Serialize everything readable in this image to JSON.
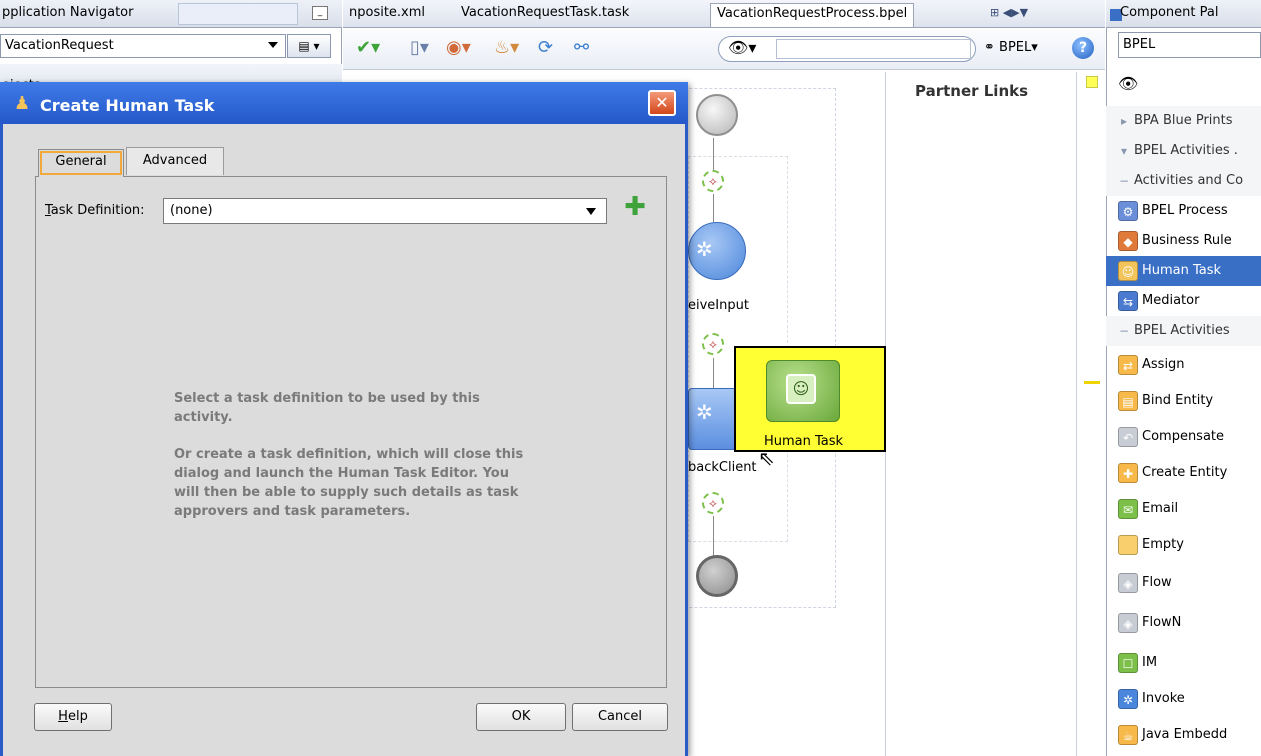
{
  "navigator": {
    "title": "pplication Navigator",
    "app_name": "VacationRequest",
    "projects_label": "ojects"
  },
  "editor": {
    "tabs": [
      {
        "label": "nposite.xml"
      },
      {
        "label": "VacationRequestTask.task"
      },
      {
        "label": "VacationRequestProcess.bpel"
      }
    ],
    "search_mode": "BPEL▾",
    "help_glyph": "?",
    "partner_links_title": "Partner Links",
    "nodes": {
      "receive_label": "eiveInput",
      "callback_label": "backClient"
    },
    "drag_item_label": "Human Task"
  },
  "palette": {
    "title": "Component Pal",
    "selected_category": "BPEL",
    "items": [
      {
        "label": "BPA Blue Prints",
        "kind": "collapsed-section",
        "icon": "triangle-right-icon"
      },
      {
        "label": "BPEL Activities .",
        "kind": "expanded-section",
        "icon": "triangle-down-icon"
      },
      {
        "label": "Activities and Co",
        "kind": "subsection",
        "icon": "minus-icon"
      },
      {
        "label": "BPEL Process",
        "kind": "item",
        "icon": "bpel-process-icon",
        "color": "#6a8fd8"
      },
      {
        "label": "Business Rule",
        "kind": "item",
        "icon": "business-rule-icon",
        "color": "#e07a3a"
      },
      {
        "label": "Human Task",
        "kind": "selected",
        "icon": "human-task-icon",
        "color": "#f2c45a"
      },
      {
        "label": "Mediator",
        "kind": "item",
        "icon": "mediator-icon",
        "color": "#4a7bd0"
      },
      {
        "label": "BPEL Activities",
        "kind": "subsection",
        "icon": "minus-icon"
      },
      {
        "label": "Assign",
        "kind": "item",
        "icon": "assign-icon",
        "color": "#f6b94a"
      },
      {
        "label": "Bind Entity",
        "kind": "item",
        "icon": "bind-entity-icon",
        "color": "#f6b94a"
      },
      {
        "label": "Compensate",
        "kind": "item",
        "icon": "compensate-icon",
        "color": "#c8ccd4"
      },
      {
        "label": "Create Entity",
        "kind": "item",
        "icon": "create-entity-icon",
        "color": "#f6b94a"
      },
      {
        "label": "Email",
        "kind": "item",
        "icon": "email-icon",
        "color": "#7cc04a"
      },
      {
        "label": "Empty",
        "kind": "item",
        "icon": "empty-icon",
        "color": "#f9cf6e"
      },
      {
        "label": "Flow",
        "kind": "item",
        "icon": "flow-icon",
        "color": "#c8ccd4"
      },
      {
        "label": "FlowN",
        "kind": "item",
        "icon": "flown-icon",
        "color": "#c8ccd4"
      },
      {
        "label": "IM",
        "kind": "item",
        "icon": "im-icon",
        "color": "#7cc04a"
      },
      {
        "label": "Invoke",
        "kind": "item",
        "icon": "invoke-icon",
        "color": "#4a86db"
      },
      {
        "label": "Java Embedd",
        "kind": "item",
        "icon": "java-embedding-icon",
        "color": "#f6b94a"
      }
    ]
  },
  "dialog": {
    "title": "Create Human Task",
    "close_glyph": "✕",
    "tabs": {
      "general": "General",
      "advanced": "Advanced"
    },
    "task_definition": {
      "label_rest": "ask Definition:",
      "mnemonic": "T",
      "value": "(none)",
      "add_glyph": "✚"
    },
    "info_text_1": "Select a task definition to be used by this activity.",
    "info_text_2": "Or create a task definition, which will close this dialog and launch the Human Task Editor. You will then be able to supply such details as task approvers and task parameters.",
    "buttons": {
      "help_mnemonic": "H",
      "help_rest": "elp",
      "ok": "OK",
      "cancel": "Cancel"
    }
  }
}
